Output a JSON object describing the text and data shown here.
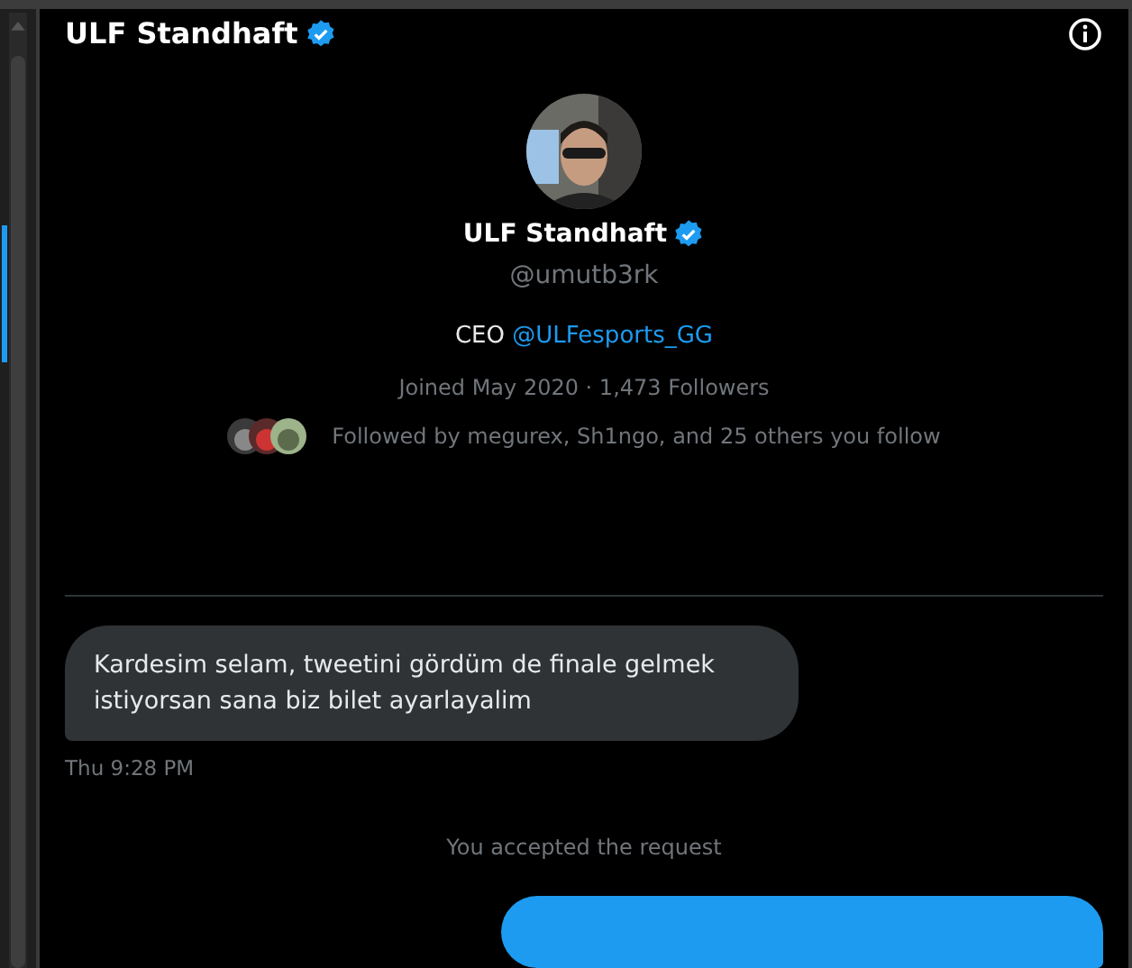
{
  "header": {
    "title": "ULF Standhaft",
    "verified": true
  },
  "profile": {
    "name": "ULF Standhaft",
    "verified": true,
    "handle": "@umutb3rk",
    "bio": "CEO",
    "bio_link": "@ULFesports_GG",
    "joined": "Joined May 2020 · 1,473 Followers",
    "followed_by": "Followed by megurex, Sh1ngo, and 25 others you follow"
  },
  "messages": [
    {
      "kind": "received",
      "text": "Kardesim selam, tweetini gördüm de finale gelmek istiyorsan sana biz bilet ayarlayalim",
      "time": "Thu 9:28 PM"
    },
    {
      "kind": "notice",
      "text": "You accepted the request"
    },
    {
      "kind": "sent"
    }
  ]
}
